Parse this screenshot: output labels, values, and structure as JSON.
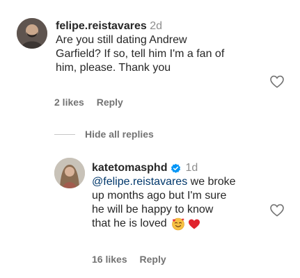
{
  "comment": {
    "username": "felipe.reistavares",
    "time": "2d",
    "lines": [
      "Are you still dating Andrew",
      "Garfield? If so, tell him I'm a fan of",
      "him, please. Thank you"
    ],
    "likes": "2 likes",
    "reply_label": "Reply"
  },
  "replies_toggle": "Hide all replies",
  "reply": {
    "username": "katetomasphd",
    "verified_icon": "verified-badge-icon",
    "time": "1d",
    "mention": "@felipe.reistavares",
    "line1_rest": " we broke",
    "lines": [
      "up months ago but I'm sure",
      "he will be happy to know",
      "that he is loved"
    ],
    "emojis": [
      "smiling-face-with-hearts-icon",
      "red-heart-icon"
    ],
    "likes": "16 likes",
    "reply_label": "Reply"
  },
  "colors": {
    "text": "#262626",
    "secondary": "#737373",
    "link": "#00376b",
    "verified": "#0095f6",
    "heart_red": "#ed4956"
  }
}
